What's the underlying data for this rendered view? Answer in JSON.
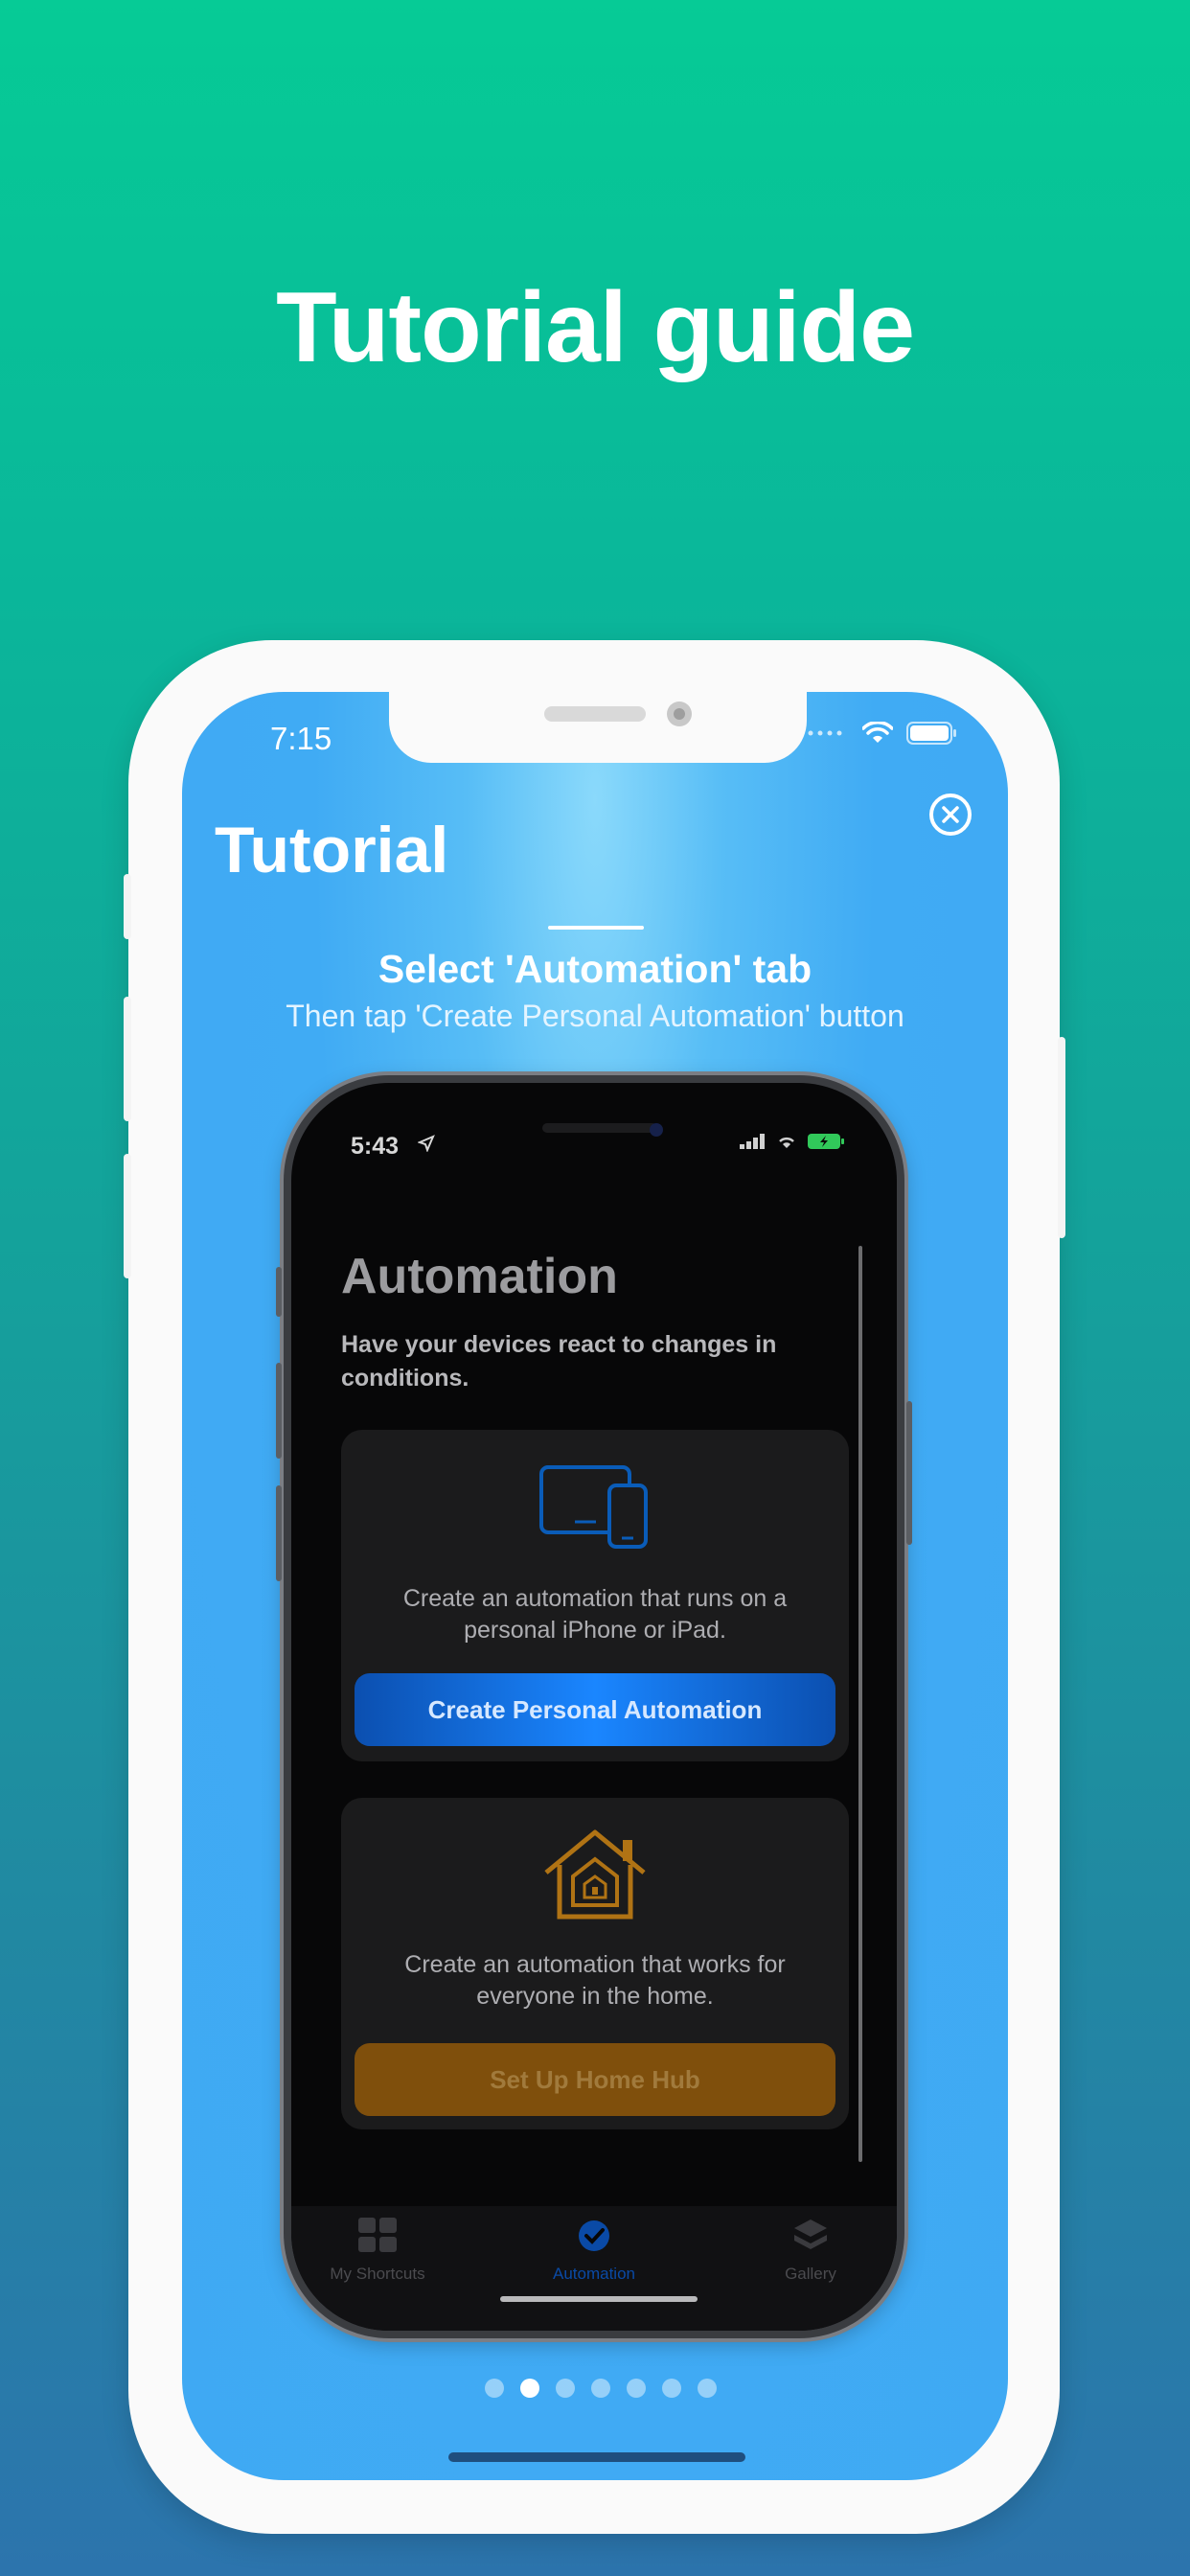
{
  "headline": "Tutorial guide",
  "status_bar": {
    "time": "7:15"
  },
  "tutorial": {
    "title": "Tutorial",
    "step_title": "Select 'Automation' tab",
    "step_subtitle": "Then tap 'Create Personal Automation' button",
    "page_count": 7,
    "current_page": 2
  },
  "mockup": {
    "status_time": "5:43",
    "heading": "Automation",
    "description": "Have your devices react to changes in conditions.",
    "personal_card": {
      "icon": "ipad-iphone-icon",
      "text": "Create an automation that runs on a personal iPhone or iPad.",
      "button_label": "Create Personal Automation"
    },
    "home_card": {
      "icon": "home-icon",
      "text": "Create an automation that works for everyone in the home.",
      "button_label": "Set Up Home Hub"
    },
    "tabs": [
      {
        "label": "My Shortcuts",
        "icon": "grid-icon"
      },
      {
        "label": "Automation",
        "icon": "clock-check-icon"
      },
      {
        "label": "Gallery",
        "icon": "layers-icon"
      }
    ]
  },
  "colors": {
    "accent_blue": "#0a84ff",
    "home_orange": "#c07f1c",
    "screen_blue": "#3fa9f3",
    "background_top": "#06cb96",
    "background_bottom": "#2c74ad"
  }
}
